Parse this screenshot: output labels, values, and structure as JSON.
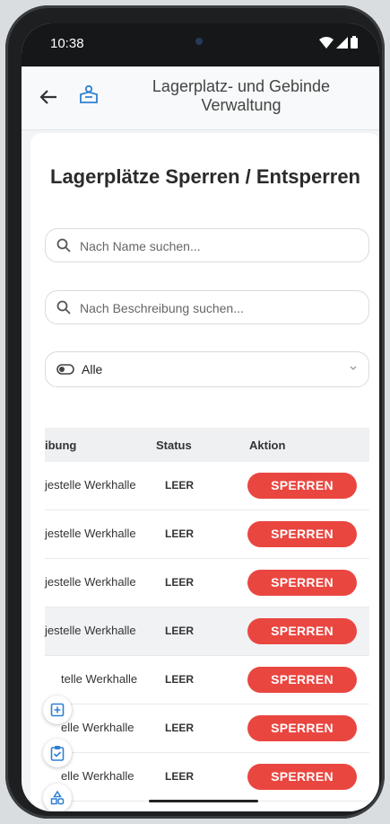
{
  "statusbar": {
    "time": "10:38"
  },
  "appbar": {
    "title": "Lagerplatz- und Gebinde Verwaltung",
    "back_icon": "arrow-left-icon",
    "logo_icon": "warehouse-user-icon"
  },
  "page": {
    "title": "Lagerplätze Sperren / Entsperren"
  },
  "search_name": {
    "placeholder": "Nach Name suchen..."
  },
  "search_desc": {
    "placeholder": "Nach Beschreibung suchen..."
  },
  "status_filter": {
    "value": "Alle"
  },
  "table": {
    "headers": {
      "description": "ibung",
      "status": "Status",
      "action": "Aktion"
    },
    "rows": [
      {
        "description": "jestelle Werkhalle",
        "status": "LEER",
        "action": "SPERREN"
      },
      {
        "description": "jestelle Werkhalle",
        "status": "LEER",
        "action": "SPERREN"
      },
      {
        "description": "jestelle Werkhalle",
        "status": "LEER",
        "action": "SPERREN"
      },
      {
        "description": "jestelle Werkhalle",
        "status": "LEER",
        "action": "SPERREN"
      },
      {
        "description": "     telle Werkhalle",
        "status": "LEER",
        "action": "SPERREN"
      },
      {
        "description": "     elle Werkhalle",
        "status": "LEER",
        "action": "SPERREN"
      },
      {
        "description": "     elle Werkhalle",
        "status": "LEER",
        "action": "SPERREN"
      }
    ]
  },
  "colors": {
    "accent": "#ea4640",
    "brand": "#2f80d1"
  }
}
